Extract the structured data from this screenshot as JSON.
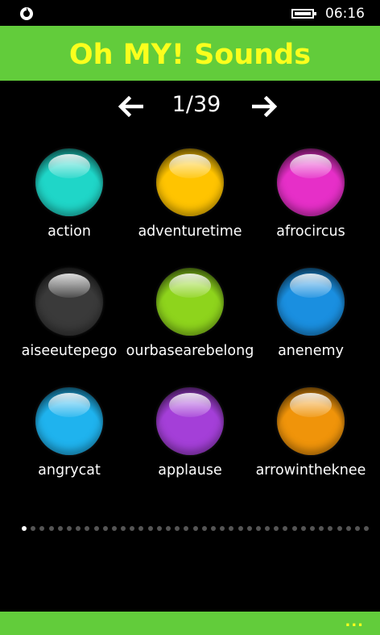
{
  "status": {
    "time": "06:16"
  },
  "header": {
    "title": "Oh MY! Sounds"
  },
  "pager": {
    "indicator": "1/39",
    "prev_icon": "arrow-left-icon",
    "next_icon": "arrow-right-icon"
  },
  "sounds": [
    {
      "label": "action",
      "color": "#1fd6c8"
    },
    {
      "label": "adventuretime",
      "color": "#ffc400"
    },
    {
      "label": "afrocircus",
      "color": "#e62fc8"
    },
    {
      "label": "aiseeutepego",
      "color": "#3a3a3a"
    },
    {
      "label": "ourbasearebelong",
      "color": "#8ed41c"
    },
    {
      "label": "anenemy",
      "color": "#1a8fe0"
    },
    {
      "label": "angrycat",
      "color": "#1fb3ee"
    },
    {
      "label": "applause",
      "color": "#a43fd8"
    },
    {
      "label": "arrowintheknee",
      "color": "#f0940a"
    }
  ],
  "pagination": {
    "total": 39,
    "current": 1
  },
  "app_bar": {
    "more_label": "..."
  },
  "colors": {
    "accent": "#62cc3b",
    "title_text": "#fbff1d"
  }
}
